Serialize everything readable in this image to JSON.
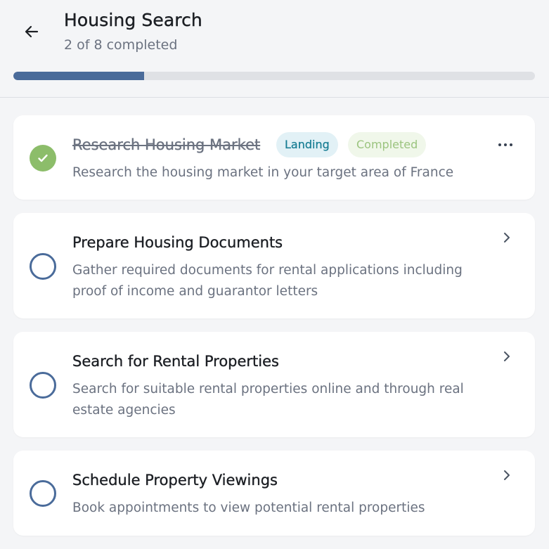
{
  "header": {
    "back_icon": "arrow-left-icon",
    "title": "Housing Search",
    "subtitle": "2 of 8 completed",
    "progress_fraction": 0.25,
    "progress_color": "#4a6b9a"
  },
  "tasks": [
    {
      "title": "Research Housing Market",
      "description": "Research the housing market in your target area of France",
      "status": "completed",
      "badges": [
        "Landing",
        "Completed"
      ],
      "action_icon": "more-horizontal-icon"
    },
    {
      "title": "Prepare Housing Documents",
      "description": "Gather required documents for rental applications including proof of income and guarantor letters",
      "status": "open",
      "action_icon": "chevron-right-icon"
    },
    {
      "title": "Search for Rental Properties",
      "description": "Search for suitable rental properties online and through real estate agencies",
      "status": "open",
      "action_icon": "chevron-right-icon"
    },
    {
      "title": "Schedule Property Viewings",
      "description": "Book appointments to view potential rental properties",
      "status": "open",
      "action_icon": "chevron-right-icon"
    }
  ],
  "colors": {
    "accent": "#4a6b9a",
    "done": "#8cbd6a",
    "landing_badge": "#1a7f95",
    "completed_badge": "#9bc47f"
  }
}
